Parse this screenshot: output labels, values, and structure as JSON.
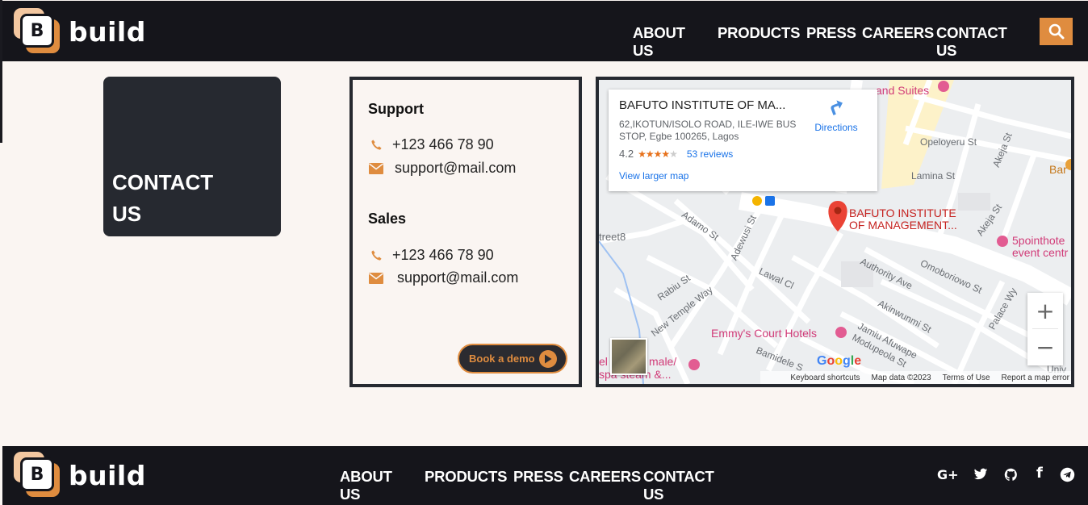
{
  "brand": {
    "logo_letter": "B",
    "name": "build"
  },
  "header": {
    "nav": [
      "ABOUT US",
      "PRODUCTS",
      "PRESS",
      "CAREERS",
      "CONTACT US"
    ],
    "search_icon": "search-icon",
    "accent": "#df8c3f",
    "background": "#15151b"
  },
  "contact_tile": {
    "title_line1": "CONTACT",
    "title_line2": "US"
  },
  "support": {
    "title": "Support",
    "phone": "+123 466 78 90",
    "email": "support@mail.com"
  },
  "sales": {
    "title": "Sales",
    "phone": "+123 466 78 90",
    "email": "support@mail.com"
  },
  "demo_button": {
    "label": "Book a demo"
  },
  "map": {
    "place_name": "BAFUTO INSTITUTE OF MA...",
    "address": "62,IKOTUN/ISOLO ROAD, ILE-IWE BUS STOP, Egbe 100265, Lagos",
    "rating": "4.2",
    "stars_filled": 4,
    "reviews": "53 reviews",
    "directions": "Directions",
    "view_larger": "View larger map",
    "marker_label_1": "BAFUTO INSTITUTE",
    "marker_label_2": "OF MANAGEMENT...",
    "streets": {
      "opeloyeru": "Opeloyeru St",
      "lamina": "Lamina St",
      "akeja": "Akeja St",
      "adamo": "Adamo St",
      "adewusi": "Adewusi St",
      "street8": "treet8",
      "rabiu": "Rabiu St",
      "lawal": "Lawal Cl",
      "authority": "Authority Ave",
      "omoboriowo": "Omoboriowo St",
      "akinwunmi": "Akinwunmi St",
      "palace": "Palace Wy",
      "new_temple": "New Temple Way",
      "jamiu": "Jamiu Afuwape",
      "modupeola": "Modupeola St",
      "bamidele": "Bamidele S",
      "univ": "Univ"
    },
    "pois": {
      "suites": "and Suites",
      "bar": "Bar",
      "fivepoint_1": "5pointhote",
      "fivepoint_2": "event centr",
      "emmys": "Emmy's Court Hotels",
      "male_1": "male/",
      "male_2": "spa steam &...",
      "el": "el"
    },
    "google": "Google",
    "footer_links": [
      "Keyboard shortcuts",
      "Map data ©2023",
      "Terms of Use",
      "Report a map error"
    ],
    "zoom_in": "+",
    "zoom_out": "−"
  },
  "footer": {
    "nav": [
      "ABOUT US",
      "PRODUCTS",
      "PRESS",
      "CAREERS",
      "CONTACT US"
    ],
    "social_icons": [
      "google-plus-icon",
      "twitter-icon",
      "github-icon",
      "facebook-icon",
      "telegram-icon"
    ],
    "google_plus": "G+",
    "facebook": "f"
  }
}
